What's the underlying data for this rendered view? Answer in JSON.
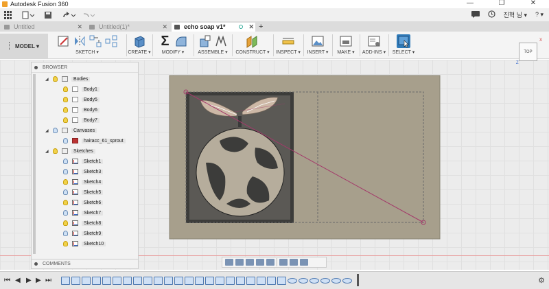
{
  "window": {
    "title": "Autodesk Fusion 360",
    "minimize": "—",
    "maximize": "❐",
    "close": "✕"
  },
  "qat": {
    "user": "진혁 님 ▾",
    "help": "? ▾"
  },
  "tabs": [
    {
      "label": "Untitled",
      "close": "✕"
    },
    {
      "label": "Untitled(1)*",
      "close": "✕"
    },
    {
      "label": "echo soap v1*",
      "close": "✕"
    },
    {
      "label": "+",
      "close": ""
    }
  ],
  "ribbon": {
    "model": "MODEL ▾",
    "groups": [
      {
        "label": "SKETCH ▾"
      },
      {
        "label": "CREATE ▾"
      },
      {
        "label": "MODIFY ▾"
      },
      {
        "label": "ASSEMBLE ▾"
      },
      {
        "label": "CONSTRUCT ▾"
      },
      {
        "label": "INSPECT ▾"
      },
      {
        "label": "INSERT ▾"
      },
      {
        "label": "MAKE ▾"
      },
      {
        "label": "ADD-INS ▾"
      },
      {
        "label": "SELECT ▾"
      }
    ],
    "modify_symbol": "Σ"
  },
  "browser": {
    "title": "BROWSER",
    "footer": "COMMENTS",
    "rows": [
      {
        "label": "Bodies",
        "type": "folder"
      },
      {
        "label": "Body1",
        "type": "body"
      },
      {
        "label": "Body5",
        "type": "body"
      },
      {
        "label": "Body6",
        "type": "body"
      },
      {
        "label": "Body7",
        "type": "body"
      },
      {
        "label": "Canvases",
        "type": "folder"
      },
      {
        "label": "hairacc_61_sprout",
        "type": "canvas"
      },
      {
        "label": "Sketches",
        "type": "folder"
      },
      {
        "label": "Sketch1",
        "type": "sketch"
      },
      {
        "label": "Sketch3",
        "type": "sketch"
      },
      {
        "label": "Sketch4",
        "type": "sketch"
      },
      {
        "label": "Sketch5",
        "type": "sketch"
      },
      {
        "label": "Sketch6",
        "type": "sketch"
      },
      {
        "label": "Sketch7",
        "type": "sketch"
      },
      {
        "label": "Sketch8",
        "type": "sketch"
      },
      {
        "label": "Sketch9",
        "type": "sketch"
      },
      {
        "label": "Sketch10",
        "type": "sketch"
      }
    ]
  },
  "viewcube": {
    "face": "TOP",
    "z": "Z",
    "x": "X"
  },
  "timeline": {
    "first": "⏮",
    "prev": "◀",
    "play": "▶",
    "next": "▶",
    "last": "⏭",
    "settings": "⚙"
  }
}
